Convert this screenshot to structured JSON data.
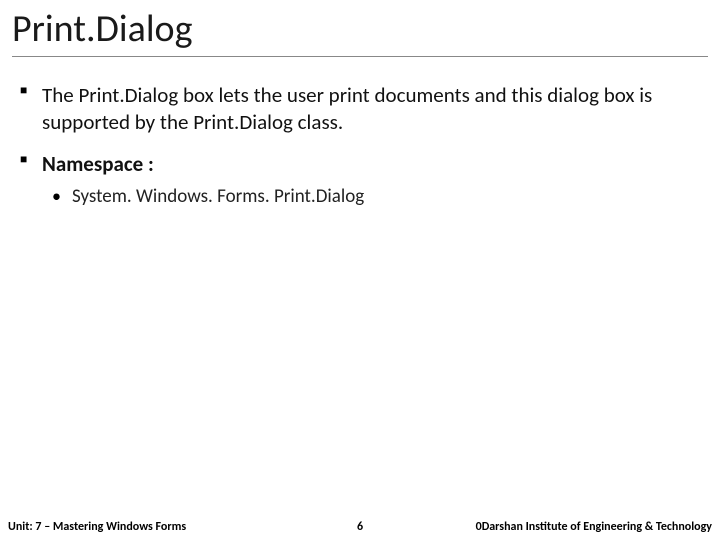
{
  "title": "Print.Dialog",
  "bullets": [
    {
      "text": "The Print.Dialog box lets the user print documents and this dialog box is supported by the Print.Dialog class.",
      "bold": false
    },
    {
      "text": "Namespace :",
      "bold": true,
      "sub": [
        "System. Windows. Forms. Print.Dialog"
      ]
    }
  ],
  "footer": {
    "left": "Unit: 7 – Mastering Windows Forms",
    "center": "6",
    "right": "0Darshan Institute of Engineering & Technology"
  }
}
